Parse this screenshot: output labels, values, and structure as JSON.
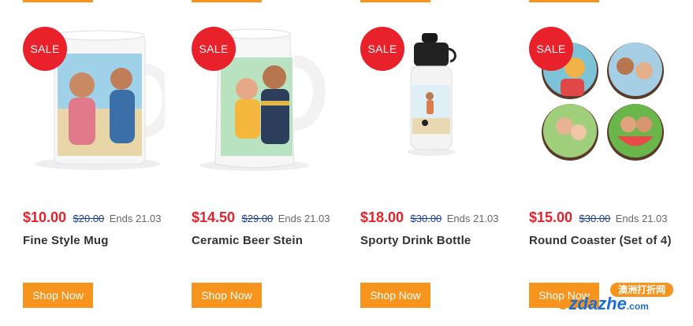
{
  "products": [
    {
      "badge": "SALE",
      "price": "$10.00",
      "was": "$20.00",
      "ends": "Ends 21.03",
      "name": "Fine Style Mug",
      "button": "Shop Now",
      "image": "photo-mug-icon"
    },
    {
      "badge": "SALE",
      "price": "$14.50",
      "was": "$29.00",
      "ends": "Ends 21.03",
      "name": "Ceramic Beer Stein",
      "button": "Shop Now",
      "image": "photo-stein-icon"
    },
    {
      "badge": "SALE",
      "price": "$18.00",
      "was": "$30.00",
      "ends": "Ends 21.03",
      "name": "Sporty Drink Bottle",
      "button": "Shop Now",
      "image": "bottle-icon"
    },
    {
      "badge": "SALE",
      "price": "$15.00",
      "was": "$30.00",
      "ends": "Ends 21.03",
      "name": "Round Coaster (Set of 4)",
      "button": "Shop Now",
      "image": "coasters-icon"
    }
  ],
  "watermark": {
    "top": "澳洲打折网",
    "main_a": "o",
    "main_b": "zdazhe",
    "main_c": ".com"
  },
  "colors": {
    "sale": "#e8212b",
    "button": "#f7941d",
    "old_price": "#1f3f95",
    "name": "#333333"
  }
}
